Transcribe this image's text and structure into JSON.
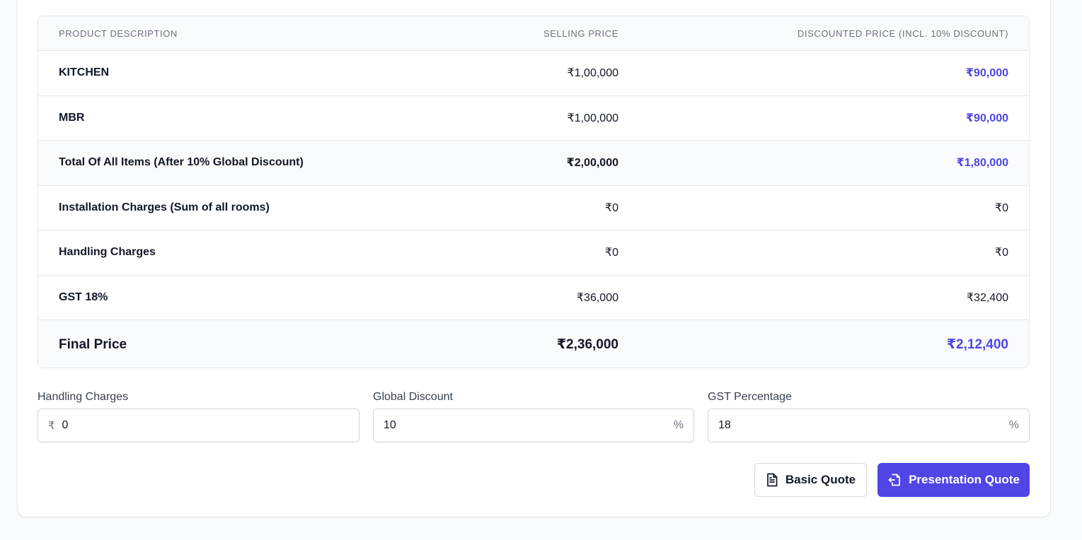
{
  "table": {
    "headers": [
      "PRODUCT DESCRIPTION",
      "SELLING PRICE",
      "DISCOUNTED PRICE (INCL. 10% DISCOUNT)"
    ],
    "rows": [
      {
        "label": "KITCHEN",
        "selling": "₹1,00,000",
        "discounted": "₹90,000"
      },
      {
        "label": "MBR",
        "selling": "₹1,00,000",
        "discounted": "₹90,000"
      },
      {
        "label": "Total Of All Items (After 10% Global Discount)",
        "selling": "₹2,00,000",
        "discounted": "₹1,80,000"
      },
      {
        "label": "Installation Charges (Sum of all rooms)",
        "selling": "₹0",
        "discounted": "₹0"
      },
      {
        "label": "Handling Charges",
        "selling": "₹0",
        "discounted": "₹0"
      },
      {
        "label": "GST 18%",
        "selling": "₹36,000",
        "discounted": "₹32,400"
      }
    ],
    "final": {
      "label": "Final Price",
      "selling": "₹2,36,000",
      "discounted": "₹2,12,400"
    }
  },
  "inputs": {
    "handling": {
      "label": "Handling Charges",
      "prefix": "₹",
      "value": "0"
    },
    "discount": {
      "label": "Global Discount",
      "value": "10",
      "suffix": "%"
    },
    "gst": {
      "label": "GST Percentage",
      "value": "18",
      "suffix": "%"
    }
  },
  "buttons": {
    "basic_quote": "Basic Quote",
    "presentation_quote": "Presentation Quote"
  },
  "colors": {
    "accent": "#4f46e5",
    "border": "#e5e7eb",
    "muted": "#6b7280"
  },
  "icons": {
    "basic_quote": "document-icon",
    "presentation_quote": "file-export-icon"
  }
}
